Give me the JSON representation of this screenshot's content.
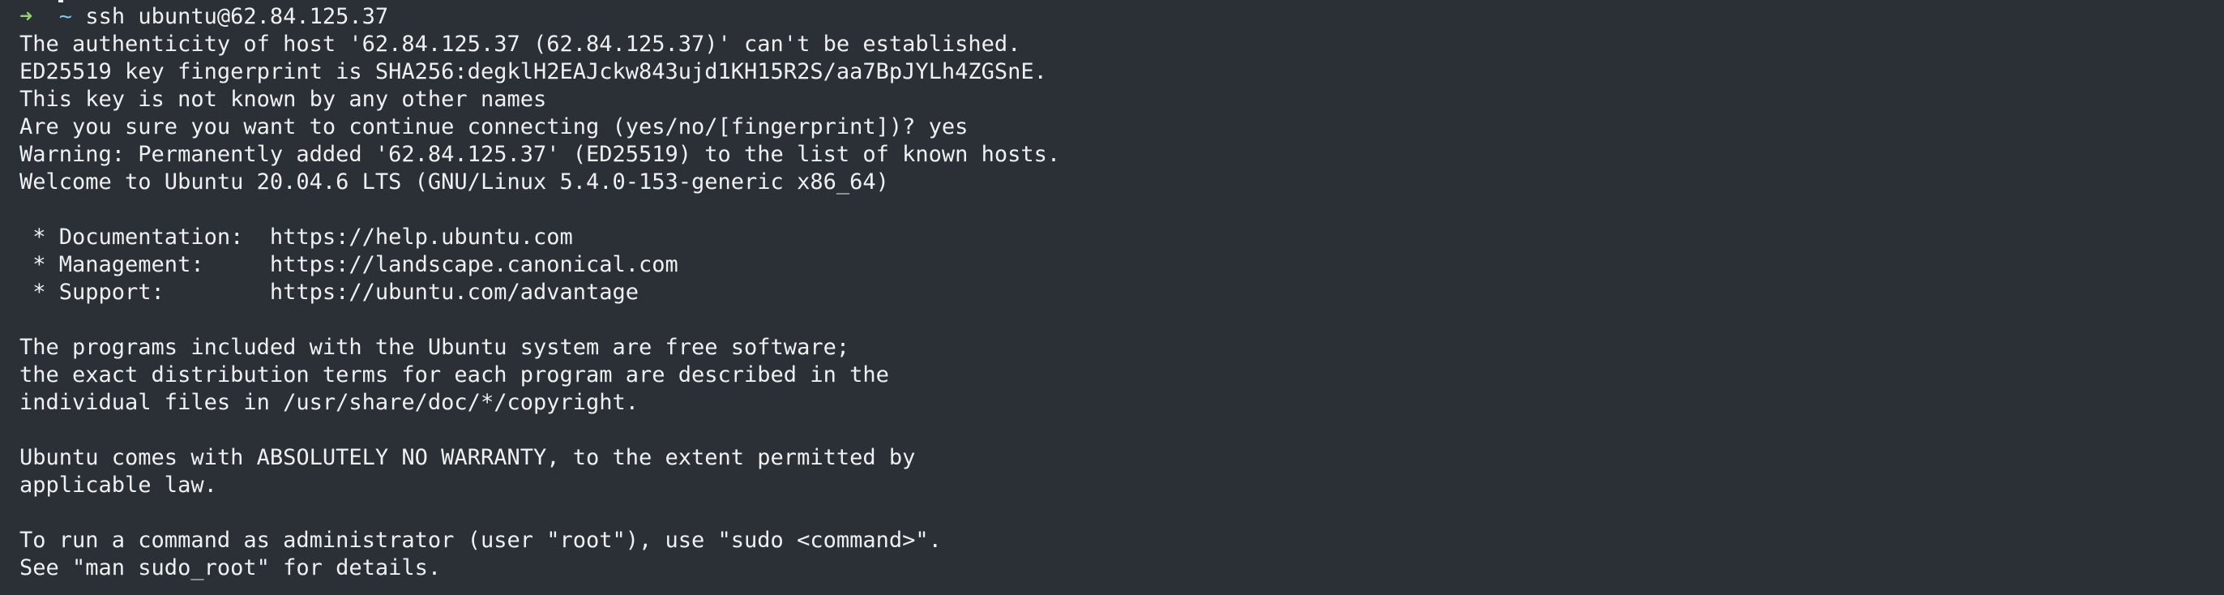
{
  "terminal": {
    "prompt": {
      "arrow": "➜",
      "dir": "~",
      "command": "ssh ubuntu@62.84.125.37"
    },
    "lines": [
      "The authenticity of host '62.84.125.37 (62.84.125.37)' can't be established.",
      "ED25519 key fingerprint is SHA256:degklH2EAJckw843ujd1KH15R2S/aa7BpJYLh4ZGSnE.",
      "This key is not known by any other names",
      "Are you sure you want to continue connecting (yes/no/[fingerprint])? yes",
      "Warning: Permanently added '62.84.125.37' (ED25519) to the list of known hosts.",
      "Welcome to Ubuntu 20.04.6 LTS (GNU/Linux 5.4.0-153-generic x86_64)",
      "",
      " * Documentation:  https://help.ubuntu.com",
      " * Management:     https://landscape.canonical.com",
      " * Support:        https://ubuntu.com/advantage",
      "",
      "The programs included with the Ubuntu system are free software;",
      "the exact distribution terms for each program are described in the",
      "individual files in /usr/share/doc/*/copyright.",
      "",
      "Ubuntu comes with ABSOLUTELY NO WARRANTY, to the extent permitted by",
      "applicable law.",
      "",
      "To run a command as administrator (user \"root\"), use \"sudo <command>\".",
      "See \"man sudo_root\" for details."
    ]
  },
  "colors": {
    "background": "#2b3036",
    "foreground": "#eef0f2",
    "prompt_arrow": "#8fd16e",
    "prompt_dir": "#79c7e6"
  }
}
